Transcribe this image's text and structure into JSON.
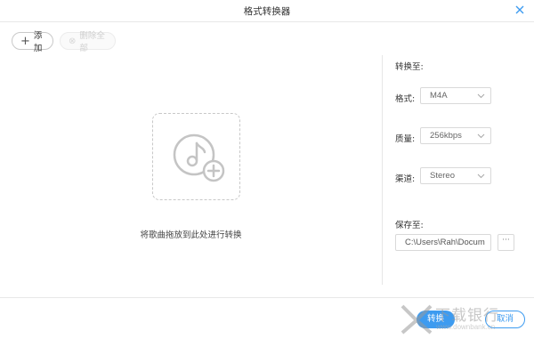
{
  "window": {
    "title": "格式转换器"
  },
  "toolbar": {
    "add_label": "添加",
    "delete_all_label": "删除全部"
  },
  "dropzone": {
    "hint": "将歌曲拖放到此处进行转换"
  },
  "settings": {
    "convert_to_label": "转换至:",
    "format_label": "格式:",
    "format_value": "M4A",
    "quality_label": "质量:",
    "quality_value": "256kbps",
    "channel_label": "渠道:",
    "channel_value": "Stereo",
    "save_to_label": "保存至:",
    "save_path": "C:\\Users\\Rah\\Docum",
    "browse_label": "···"
  },
  "footer": {
    "ok_label": "转换",
    "cancel_label": "取消"
  },
  "watermark": {
    "text": "下载银行",
    "url": "www.downbank.cn"
  },
  "colors": {
    "accent": "#3d9bf0",
    "border": "#d9d9d9"
  }
}
